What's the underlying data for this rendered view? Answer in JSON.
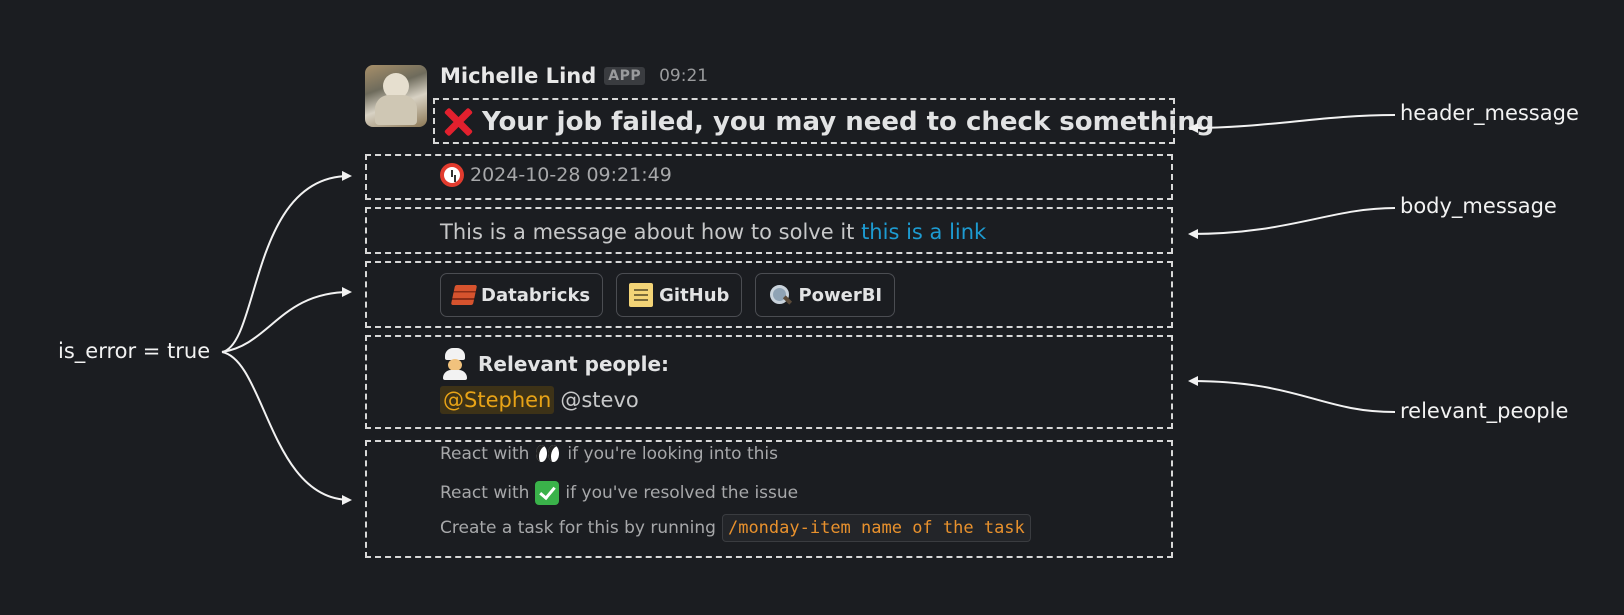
{
  "message": {
    "author": "Michelle Lind",
    "app_badge": "APP",
    "time": "09:21",
    "header": "Your job failed, you may need to check something",
    "timestamp": "2024-10-28 09:21:49",
    "body_text": "This is a message about how to solve it",
    "body_link": "this is a link",
    "buttons": [
      {
        "label": "Databricks",
        "icon": "databricks-icon"
      },
      {
        "label": "GitHub",
        "icon": "memo-icon"
      },
      {
        "label": "PowerBI",
        "icon": "magnifier-icon"
      }
    ],
    "people_title": "Relevant people:",
    "mentions": [
      "@Stephen",
      "@stevo"
    ],
    "context": {
      "line1_prefix": "React with",
      "line1_suffix": "if you're looking into this",
      "line2_prefix": "React with",
      "line2_suffix": "if you've resolved the issue",
      "line3_prefix": "Create a task for this by running",
      "line3_code": "/monday-item name of the task"
    }
  },
  "annotations": {
    "header": "header_message",
    "body": "body_message",
    "people": "relevant_people",
    "error": "is_error = true"
  },
  "colors": {
    "background": "#1b1d21",
    "link": "#1d9bd1",
    "mention_highlight": "#e8a317",
    "code": "#e8912d",
    "error_x": "#e3202e"
  }
}
